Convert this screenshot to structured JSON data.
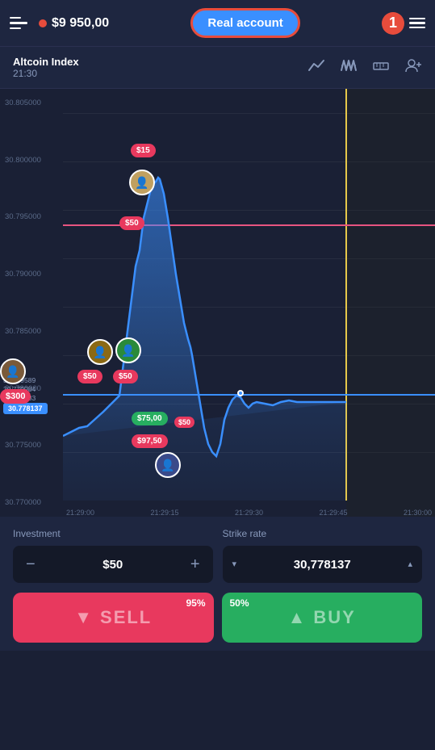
{
  "header": {
    "hamburger_label": "menu",
    "balance": "$9 950,00",
    "real_account_label": "Real account",
    "notification_count": "1",
    "lines_label": "options"
  },
  "toolbar": {
    "asset_name": "Altcoin Index",
    "asset_time": "21:30",
    "icons": [
      "trend-icon",
      "oscillator-icon",
      "ruler-icon",
      "add-user-icon"
    ]
  },
  "chart": {
    "y_labels": [
      "30.805000",
      "30.800000",
      "30.795000",
      "30.790000",
      "30.785000",
      "30.780000",
      "30.775000",
      "30.770000"
    ],
    "x_labels": [
      "21:29:00",
      "21:29:15",
      "21:29:30",
      "21:29:45",
      "21:30:00"
    ],
    "current_price": "30.778137",
    "price_stack": [
      "30.779589",
      "30.779984",
      "30.779783",
      "30.778137"
    ],
    "trade_labels": [
      {
        "text": "$15",
        "color": "pink"
      },
      {
        "text": "$50",
        "color": "pink"
      },
      {
        "text": "$50",
        "color": "pink"
      },
      {
        "text": "$50",
        "color": "pink"
      },
      {
        "text": "$300",
        "color": "pink"
      },
      {
        "text": "$75,00",
        "color": "green"
      },
      {
        "text": "$50",
        "color": "pink"
      },
      {
        "text": "$97,50",
        "color": "pink"
      }
    ]
  },
  "investment": {
    "label": "Investment",
    "value": "$50",
    "minus_label": "−",
    "plus_label": "+"
  },
  "strike_rate": {
    "label": "Strike rate",
    "value": "30,778137",
    "down_label": "▾",
    "up_label": "▴"
  },
  "sell_button": {
    "label": "SELL",
    "percent": "95%",
    "icon": "chevron-down"
  },
  "buy_button": {
    "label": "BUY",
    "percent": "50%",
    "icon": "chevron-up"
  }
}
